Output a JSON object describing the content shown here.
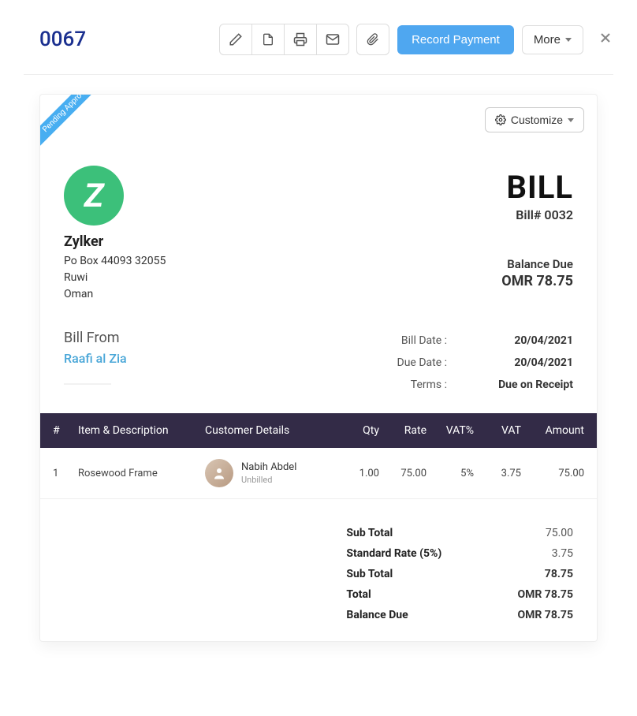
{
  "header": {
    "doc_number": "0067",
    "record_payment_label": "Record Payment",
    "more_label": "More"
  },
  "ribbon": {
    "text": "Pending Approval"
  },
  "customize": {
    "label": "Customize"
  },
  "company": {
    "logo_letter": "Z",
    "name": "Zylker",
    "addr1": "Po Box 44093 32055",
    "addr2": "Ruwi",
    "addr3": "Oman"
  },
  "bill_header": {
    "title": "BILL",
    "number": "Bill# 0032",
    "balance_label": "Balance Due",
    "balance_value": "OMR 78.75"
  },
  "bill_from": {
    "label": "Bill From",
    "name": "Raafi al Zia"
  },
  "meta": {
    "bill_date_label": "Bill Date :",
    "bill_date_value": "20/04/2021",
    "due_date_label": "Due Date :",
    "due_date_value": "20/04/2021",
    "terms_label": "Terms :",
    "terms_value": "Due on Receipt"
  },
  "table": {
    "headers": {
      "hash": "#",
      "desc": "Item & Description",
      "cust": "Customer Details",
      "qty": "Qty",
      "rate": "Rate",
      "vatp": "VAT%",
      "vat": "VAT",
      "amt": "Amount"
    },
    "row": {
      "hash": "1",
      "desc": "Rosewood Frame",
      "cust_name": "Nabih Abdel",
      "cust_status": "Unbilled",
      "qty": "1.00",
      "rate": "75.00",
      "vatp": "5%",
      "vat": "3.75",
      "amt": "75.00"
    }
  },
  "totals": {
    "sub1_label": "Sub Total",
    "sub1_value": "75.00",
    "std_label": "Standard Rate (5%)",
    "std_value": "3.75",
    "sub2_label": "Sub Total",
    "sub2_value": "78.75",
    "total_label": "Total",
    "total_value": "OMR 78.75",
    "balance_label": "Balance Due",
    "balance_value": "OMR 78.75"
  }
}
